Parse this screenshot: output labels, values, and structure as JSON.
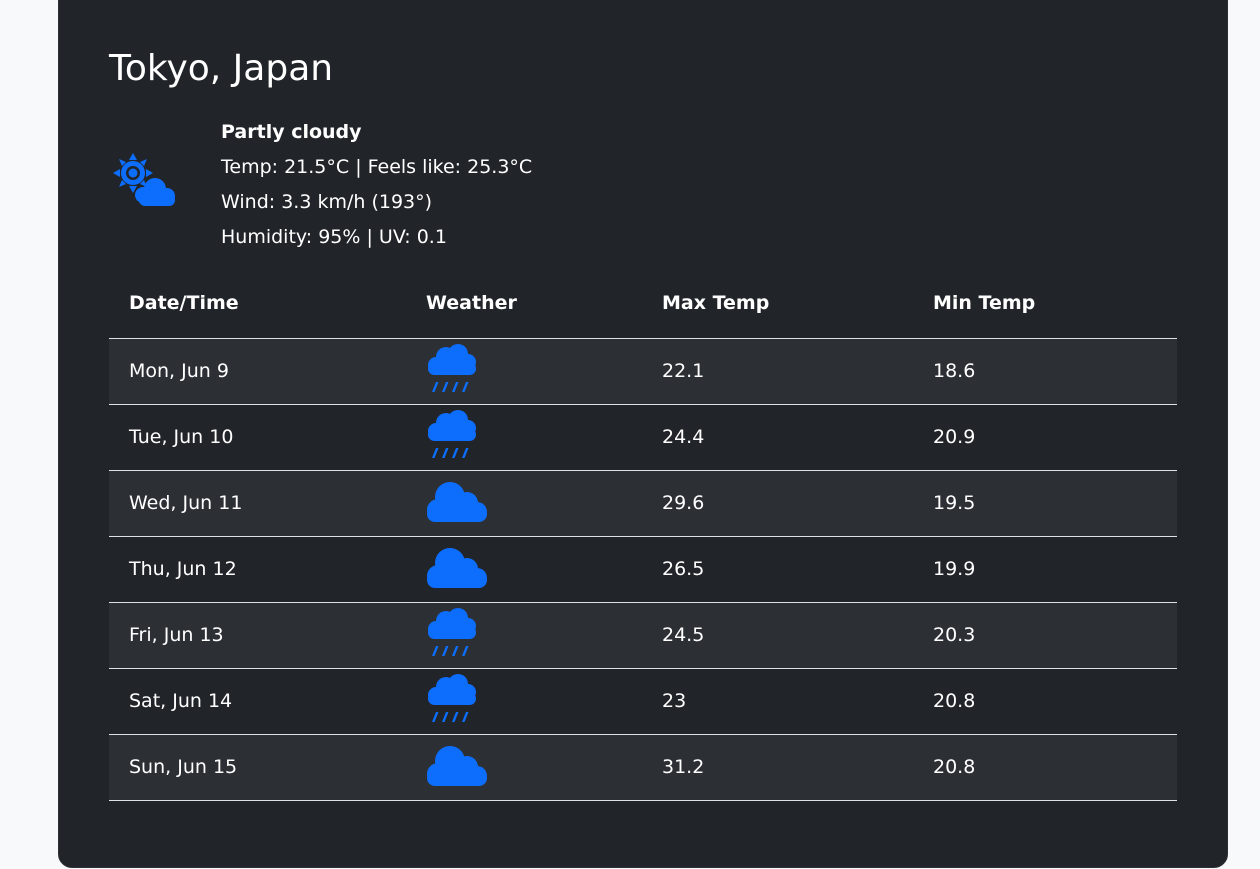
{
  "location": {
    "title": "Tokyo, Japan"
  },
  "current": {
    "icon": "partly-cloudy-icon",
    "condition": "Partly cloudy",
    "temp_line": "Temp: 21.5°C  | Feels like: 25.3°C",
    "wind_line": "Wind: 3.3 km/h (193°)",
    "humidity_line": "Humidity: 95% | UV: 0.1"
  },
  "forecast": {
    "headers": [
      "Date/Time",
      "Weather",
      "Max Temp",
      "Min Temp"
    ],
    "rows": [
      {
        "date": "Mon, Jun 9",
        "icon": "rain-icon",
        "max": "22.1",
        "min": "18.6"
      },
      {
        "date": "Tue, Jun 10",
        "icon": "rain-icon",
        "max": "24.4",
        "min": "20.9"
      },
      {
        "date": "Wed, Jun 11",
        "icon": "cloud-icon",
        "max": "29.6",
        "min": "19.5"
      },
      {
        "date": "Thu, Jun 12",
        "icon": "cloud-icon",
        "max": "26.5",
        "min": "19.9"
      },
      {
        "date": "Fri, Jun 13",
        "icon": "rain-icon",
        "max": "24.5",
        "min": "20.3"
      },
      {
        "date": "Sat, Jun 14",
        "icon": "rain-icon",
        "max": "23",
        "min": "20.8"
      },
      {
        "date": "Sun, Jun 15",
        "icon": "cloud-icon",
        "max": "31.2",
        "min": "20.8"
      }
    ]
  },
  "colors": {
    "card_bg": "#212529",
    "page_bg": "#f8f9fb",
    "icon_blue": "#0d6efd",
    "text": "#ffffff",
    "row_stripe": "#2c3035"
  }
}
